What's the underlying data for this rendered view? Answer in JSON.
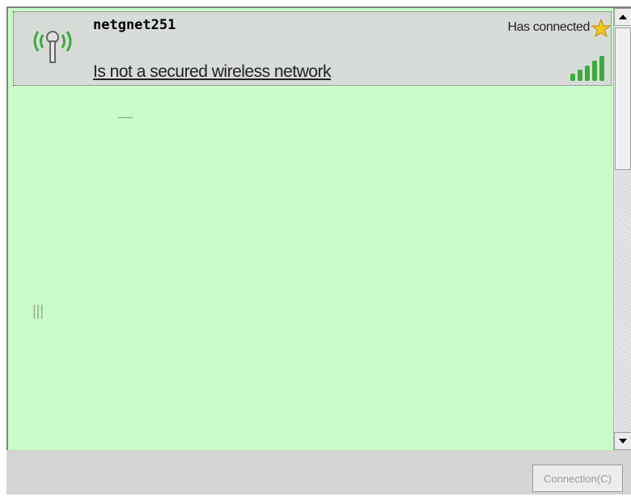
{
  "network": {
    "name": "netgnet251",
    "connection_state": "Has connected",
    "security": "Is not a secured wireless network"
  },
  "buttons": {
    "connect_label": "Connection(C)"
  },
  "colors": {
    "list_background": "#c8fcc8",
    "selected_row": "#d8dcd8",
    "signal_green": "#3caa3c",
    "star_yellow": "#f2c820"
  },
  "icons": {
    "tower": "wireless-tower-icon",
    "star": "star-icon",
    "signal": "signal-strength-icon",
    "up": "scroll-up-arrow-icon",
    "down": "scroll-down-arrow-icon"
  }
}
